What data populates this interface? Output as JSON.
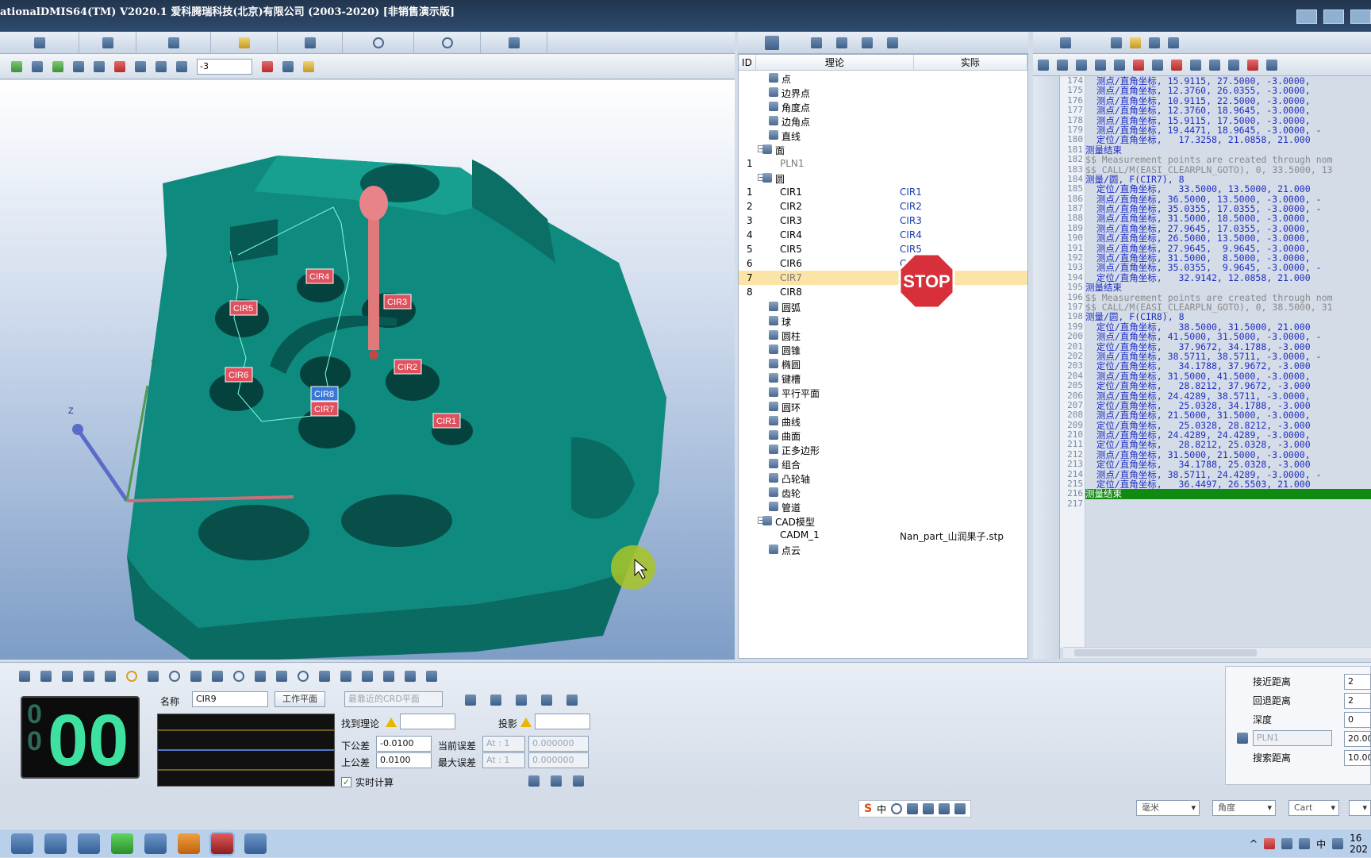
{
  "window": {
    "title": "ationalDMIS64(TM) V2020.1    爱科腾瑞科技(北京)有限公司 (2003-2020) [非销售演示版]"
  },
  "view_toolbar": {
    "value_input": "-3"
  },
  "viewport": {
    "labels": [
      "CIR4",
      "CIR3",
      "CIR5",
      "CIR2",
      "CIR6",
      "CIR8",
      "CIR7",
      "CIR1"
    ],
    "axis_z": "Z",
    "axis_y": "Y"
  },
  "tree": {
    "headers": {
      "id": "ID",
      "theory": "理论",
      "actual": "实际"
    },
    "rows": [
      {
        "id": "",
        "name": "点",
        "actual": "",
        "indent": 1
      },
      {
        "id": "",
        "name": "边界点",
        "actual": "",
        "indent": 1
      },
      {
        "id": "",
        "name": "角度点",
        "actual": "",
        "indent": 1
      },
      {
        "id": "",
        "name": "边角点",
        "actual": "",
        "indent": 1
      },
      {
        "id": "",
        "name": "直线",
        "actual": "",
        "indent": 1
      },
      {
        "id": "",
        "name": "面",
        "actual": "",
        "indent": 0,
        "expand": "−"
      },
      {
        "id": "1",
        "name": "PLN1",
        "actual": "",
        "indent": 2,
        "muted": true
      },
      {
        "id": "",
        "name": "圆",
        "actual": "",
        "indent": 0,
        "expand": "−"
      },
      {
        "id": "1",
        "name": "CIR1",
        "actual": "CIR1",
        "indent": 2
      },
      {
        "id": "2",
        "name": "CIR2",
        "actual": "CIR2",
        "indent": 2
      },
      {
        "id": "3",
        "name": "CIR3",
        "actual": "CIR3",
        "indent": 2
      },
      {
        "id": "4",
        "name": "CIR4",
        "actual": "CIR4",
        "indent": 2
      },
      {
        "id": "5",
        "name": "CIR5",
        "actual": "CIR5",
        "indent": 2
      },
      {
        "id": "6",
        "name": "CIR6",
        "actual": "CIR6",
        "indent": 2
      },
      {
        "id": "7",
        "name": "CIR7",
        "actual": "",
        "indent": 2,
        "selected": true,
        "muted": true
      },
      {
        "id": "8",
        "name": "CIR8",
        "actual": "",
        "indent": 2
      },
      {
        "id": "",
        "name": "圆弧",
        "actual": "",
        "indent": 1
      },
      {
        "id": "",
        "name": "球",
        "actual": "",
        "indent": 1
      },
      {
        "id": "",
        "name": "圆柱",
        "actual": "",
        "indent": 1
      },
      {
        "id": "",
        "name": "圆锥",
        "actual": "",
        "indent": 1
      },
      {
        "id": "",
        "name": "椭圆",
        "actual": "",
        "indent": 1
      },
      {
        "id": "",
        "name": "键槽",
        "actual": "",
        "indent": 1
      },
      {
        "id": "",
        "name": "平行平面",
        "actual": "",
        "indent": 1
      },
      {
        "id": "",
        "name": "圆环",
        "actual": "",
        "indent": 1
      },
      {
        "id": "",
        "name": "曲线",
        "actual": "",
        "indent": 1
      },
      {
        "id": "",
        "name": "曲面",
        "actual": "",
        "indent": 1
      },
      {
        "id": "",
        "name": "正多边形",
        "actual": "",
        "indent": 1
      },
      {
        "id": "",
        "name": "组合",
        "actual": "",
        "indent": 1
      },
      {
        "id": "",
        "name": "凸轮轴",
        "actual": "",
        "indent": 1
      },
      {
        "id": "",
        "name": "齿轮",
        "actual": "",
        "indent": 1
      },
      {
        "id": "",
        "name": "管道",
        "actual": "",
        "indent": 1
      },
      {
        "id": "",
        "name": "CAD模型",
        "actual": "",
        "indent": 0,
        "expand": "−",
        "cad": true
      },
      {
        "id": "",
        "name": "CADM_1",
        "actual": "Nan_part_山润果子.stp",
        "indent": 2
      },
      {
        "id": "",
        "name": "点云",
        "actual": "",
        "indent": 1
      }
    ],
    "stop_sign": "STOP"
  },
  "code": {
    "lines": [
      {
        "n": "174",
        "t": "  测点/直角坐标, 15.9115, 27.5000, -3.0000,",
        "k": ""
      },
      {
        "n": "175",
        "t": "  测点/直角坐标, 12.3760, 26.0355, -3.0000,",
        "k": ""
      },
      {
        "n": "176",
        "t": "  测点/直角坐标, 10.9115, 22.5000, -3.0000,",
        "k": ""
      },
      {
        "n": "177",
        "t": "  测点/直角坐标, 12.3760, 18.9645, -3.0000,",
        "k": ""
      },
      {
        "n": "178",
        "t": "  测点/直角坐标, 15.9115, 17.5000, -3.0000,",
        "k": ""
      },
      {
        "n": "179",
        "t": "  测点/直角坐标, 19.4471, 18.9645, -3.0000, -",
        "k": ""
      },
      {
        "n": "180",
        "t": "  定位/直角坐标,   17.3258, 21.0858, 21.000",
        "k": ""
      },
      {
        "n": "181",
        "t": "测量结束",
        "k": ""
      },
      {
        "n": "182",
        "t": "$$ Measurement points are created through nom",
        "k": "c"
      },
      {
        "n": "183",
        "t": "$$ CALL/M(EASI_CLEARPLN_GOTO), 0, 33.5000, 13",
        "k": "c"
      },
      {
        "n": "184",
        "t": "测量/圆, F(CIR7), 8",
        "k": ""
      },
      {
        "n": "185",
        "t": "  定位/直角坐标,   33.5000, 13.5000, 21.000",
        "k": ""
      },
      {
        "n": "186",
        "t": "  测点/直角坐标, 36.5000, 13.5000, -3.0000, -",
        "k": ""
      },
      {
        "n": "187",
        "t": "  测点/直角坐标, 35.0355, 17.0355, -3.0000, -",
        "k": ""
      },
      {
        "n": "188",
        "t": "  测点/直角坐标, 31.5000, 18.5000, -3.0000,",
        "k": ""
      },
      {
        "n": "189",
        "t": "  测点/直角坐标, 27.9645, 17.0355, -3.0000,",
        "k": ""
      },
      {
        "n": "190",
        "t": "  测点/直角坐标, 26.5000, 13.5000, -3.0000,",
        "k": ""
      },
      {
        "n": "191",
        "t": "  测点/直角坐标, 27.9645,  9.9645, -3.0000,",
        "k": ""
      },
      {
        "n": "192",
        "t": "  测点/直角坐标, 31.5000,  8.5000, -3.0000,",
        "k": ""
      },
      {
        "n": "193",
        "t": "  测点/直角坐标, 35.0355,  9.9645, -3.0000, -",
        "k": ""
      },
      {
        "n": "194",
        "t": "  定位/直角坐标,   32.9142, 12.0858, 21.000",
        "k": ""
      },
      {
        "n": "195",
        "t": "测量结束",
        "k": ""
      },
      {
        "n": "196",
        "t": "$$ Measurement points are created through nom",
        "k": "c"
      },
      {
        "n": "197",
        "t": "$$ CALL/M(EASI_CLEARPLN_GOTO), 0, 38.5000, 31",
        "k": "c"
      },
      {
        "n": "198",
        "t": "测量/圆, F(CIR8), 8",
        "k": ""
      },
      {
        "n": "199",
        "t": "  定位/直角坐标,   38.5000, 31.5000, 21.000",
        "k": ""
      },
      {
        "n": "200",
        "t": "  测点/直角坐标, 41.5000, 31.5000, -3.0000, -",
        "k": ""
      },
      {
        "n": "201",
        "t": "  定位/直角坐标,   37.9672, 34.1788, -3.000",
        "k": ""
      },
      {
        "n": "202",
        "t": "  测点/直角坐标, 38.5711, 38.5711, -3.0000, -",
        "k": ""
      },
      {
        "n": "203",
        "t": "  定位/直角坐标,   34.1788, 37.9672, -3.000",
        "k": ""
      },
      {
        "n": "204",
        "t": "  测点/直角坐标, 31.5000, 41.5000, -3.0000,",
        "k": ""
      },
      {
        "n": "205",
        "t": "  定位/直角坐标,   28.8212, 37.9672, -3.000",
        "k": ""
      },
      {
        "n": "206",
        "t": "  测点/直角坐标, 24.4289, 38.5711, -3.0000,",
        "k": ""
      },
      {
        "n": "207",
        "t": "  定位/直角坐标,   25.0328, 34.1788, -3.000",
        "k": ""
      },
      {
        "n": "208",
        "t": "  测点/直角坐标, 21.5000, 31.5000, -3.0000,",
        "k": ""
      },
      {
        "n": "209",
        "t": "  定位/直角坐标,   25.0328, 28.8212, -3.000",
        "k": ""
      },
      {
        "n": "210",
        "t": "  测点/直角坐标, 24.4289, 24.4289, -3.0000,",
        "k": ""
      },
      {
        "n": "211",
        "t": "  定位/直角坐标,   28.8212, 25.0328, -3.000",
        "k": ""
      },
      {
        "n": "212",
        "t": "  测点/直角坐标, 31.5000, 21.5000, -3.0000,",
        "k": ""
      },
      {
        "n": "213",
        "t": "  定位/直角坐标,   34.1788, 25.0328, -3.000",
        "k": ""
      },
      {
        "n": "214",
        "t": "  测点/直角坐标, 38.5711, 24.4289, -3.0000, -",
        "k": ""
      },
      {
        "n": "215",
        "t": "  定位/直角坐标,   36.4497, 26.5503, 21.000",
        "k": ""
      },
      {
        "n": "216",
        "t": "测量结束",
        "k": "h"
      },
      {
        "n": "217",
        "t": "",
        "k": ""
      }
    ]
  },
  "feature_panel": {
    "counter_small": "0",
    "counter_small2": "0",
    "counter_big": "00",
    "name_label": "名称",
    "name_value": "CIR9",
    "workplane_btn": "工作平面",
    "nearest_crd": "最靠近的CRD平面",
    "find_theory_label": "找到理论",
    "projection_label": "投影",
    "lower_tol_label": "下公差",
    "lower_tol_value": "-0.0100",
    "upper_tol_label": "上公差",
    "upper_tol_value": "0.0100",
    "current_err_label": "当前误差",
    "max_err_label": "最大误差",
    "at_value": "At : 1",
    "err_value": "0.000000",
    "realtime_label": "实时计算"
  },
  "props": {
    "approach_label": "接近距离",
    "approach_value": "2",
    "retract_label": "回退距离",
    "retract_value": "2",
    "depth_label": "深度",
    "depth_value": "0",
    "plane_value": "PLN1",
    "plane_num": "20.00",
    "search_label": "搜索距离",
    "search_value": "10.00"
  },
  "statusbar": {
    "unit": "毫米",
    "angle": "角度",
    "coord": "Cart"
  },
  "taskbar": {
    "ime_label": "中",
    "tray_lang": "中",
    "clock_1": "16",
    "clock_2": "202"
  }
}
